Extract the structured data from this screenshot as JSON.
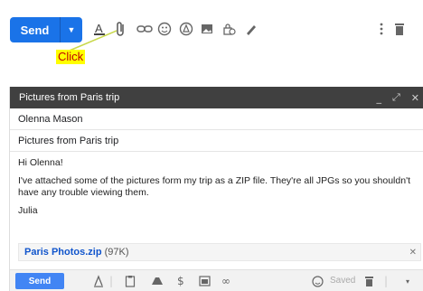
{
  "toolbar": {
    "send_label": "Send",
    "dropdown_glyph": "▼",
    "icons": [
      "text-format-icon",
      "attach-icon",
      "link-icon",
      "emoji-icon",
      "drive-icon",
      "photo-icon",
      "lock-clock-icon",
      "signature-icon",
      "more-options-icon",
      "trash-icon"
    ]
  },
  "annotation": {
    "label": "Click",
    "color": "#c00000",
    "highlight": "#ffff00"
  },
  "compose": {
    "header_title": "Pictures from Paris trip",
    "to": "Olenna Mason",
    "subject": "Pictures from Paris trip",
    "greeting": "Hi Olenna!",
    "message": "I've attached some of the pictures form my trip as a ZIP file. They're all JPGs so you shouldn't have any trouble viewing them.",
    "signature": "Julia",
    "attachment_name": "Paris Photos.zip",
    "attachment_size": "(97K)",
    "send_label": "Send",
    "saved_label": "Saved"
  },
  "colors": {
    "send_primary": "#1a73e8",
    "header_bg": "#404040",
    "link": "#1155cc"
  }
}
